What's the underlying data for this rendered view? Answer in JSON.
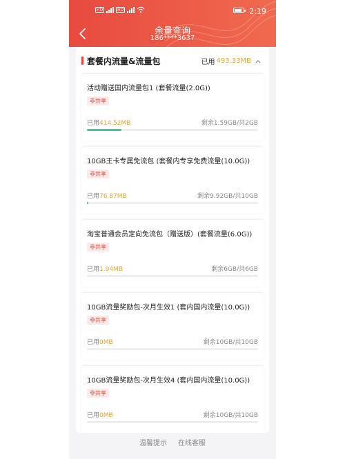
{
  "status_bar": {
    "time": "2:19",
    "hd_labels": [
      "HD",
      "HD"
    ]
  },
  "header": {
    "title": "余量查询",
    "phone": "186****3637"
  },
  "section": {
    "title": "套餐内流量&流量包",
    "used_prefix": "已用",
    "used_amount": "493.33MB"
  },
  "packages": [
    {
      "name": "活动赠送国内流量包1 (套餐流量(2.0G))",
      "badge": "非共享",
      "used_label": "已用",
      "used_value": "414.52MB",
      "remain": "剩余1.59GB/共2GB",
      "progress": 0.2
    },
    {
      "name": "10GB王卡专属免流包 (套餐内专享免费流量(10.0G))",
      "badge": "非共享",
      "used_label": "已用",
      "used_value": "76.87MB",
      "remain": "剩余9.92GB/共10GB",
      "progress": 0.008
    },
    {
      "name": "淘宝普通会员定向免流包（赠送版）(套餐流量(6.0G))",
      "badge": "非共享",
      "used_label": "已用",
      "used_value": "1.94MB",
      "remain": "剩余6GB/共6GB",
      "progress": 0.0
    },
    {
      "name": "10GB流量奖励包-次月生效1 (套内国内流量(10.0G))",
      "badge": "非共享",
      "used_label": "已用",
      "used_value": "0MB",
      "remain": "剩余10GB/共10GB",
      "progress": 0.0
    },
    {
      "name": "10GB流量奖励包-次月生效4 (套内国内流量(10.0G))",
      "badge": "非共享",
      "used_label": "已用",
      "used_value": "0MB",
      "remain": "剩余10GB/共10GB",
      "progress": 0.0
    }
  ],
  "footer": {
    "tips": "温馨提示",
    "service": "在线客服"
  },
  "colors": {
    "header": "#e84a3f",
    "accent_amount": "#e8a33a",
    "progress": "#3dc89b",
    "badge_text": "#e8443a",
    "badge_bg": "#fde9e8"
  }
}
